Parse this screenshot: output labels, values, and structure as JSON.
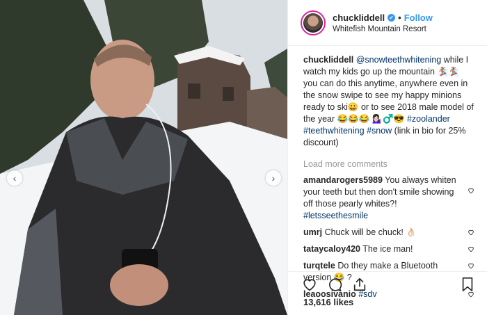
{
  "post": {
    "username": "chuckliddell",
    "verified_icon": "verified-badge-icon",
    "follow_label": "Follow",
    "location": "Whitefish Mountain Resort"
  },
  "caption": {
    "username": "chuckliddell",
    "mention": "@snowteethwhitening",
    "text1": " while I watch my kids go up the mountain 🏂🏂 you can do this anytime, anywhere even in the snow swipe to see my happy minions ready to ski😀  or to see 2018 male model of the year 😂😂😂 💁🏻‍♀️♂️😎 ",
    "tag1": "#zoolander",
    "tag2": "#teethwhitening",
    "tag3": "#snow",
    "text2": " (link in bio for 25% discount)"
  },
  "load_more": "Load more comments",
  "comments": [
    {
      "user": "amandarogers5989",
      "text": " You always whiten your teeth but then don't smile showing off those pearly whites?! ",
      "tag": "#letsseethesmile"
    },
    {
      "user": "umrj",
      "text": " Chuck will be chuck! 👌🏻",
      "tag": ""
    },
    {
      "user": "tataycaloy420",
      "text": " The ice man!",
      "tag": ""
    },
    {
      "user": "turqtele",
      "text": " Do they make a Bluetooth version 😂 ?",
      "tag": ""
    },
    {
      "user": "leaoosivanio",
      "text": " ",
      "tag": "#sdv"
    }
  ],
  "likes": "13,616 likes",
  "colors": {
    "link": "#003569",
    "follow": "#3897f0",
    "meta": "#999999"
  }
}
